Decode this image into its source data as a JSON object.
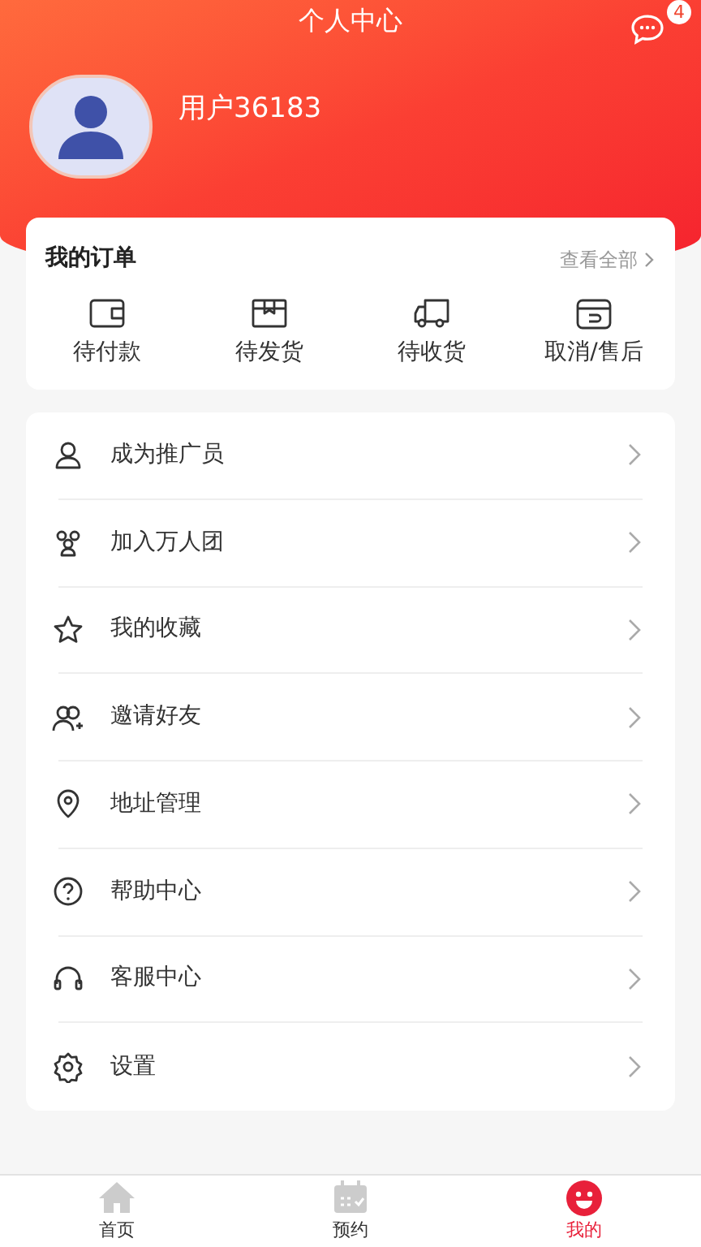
{
  "header": {
    "title": "个人中心",
    "message_badge": "4"
  },
  "profile": {
    "username": "用户36183"
  },
  "orders": {
    "title": "我的订单",
    "view_all": "查看全部",
    "items": [
      {
        "label": "待付款"
      },
      {
        "label": "待发货"
      },
      {
        "label": "待收货"
      },
      {
        "label": "取消/售后"
      }
    ]
  },
  "menu": [
    {
      "label": "成为推广员"
    },
    {
      "label": "加入万人团"
    },
    {
      "label": "我的收藏"
    },
    {
      "label": "邀请好友"
    },
    {
      "label": "地址管理"
    },
    {
      "label": "帮助中心"
    },
    {
      "label": "客服中心"
    },
    {
      "label": "设置"
    }
  ],
  "tab_bar": [
    {
      "label": "首页",
      "selected": false
    },
    {
      "label": "预约",
      "selected": false
    },
    {
      "label": "我的",
      "selected": true
    }
  ]
}
